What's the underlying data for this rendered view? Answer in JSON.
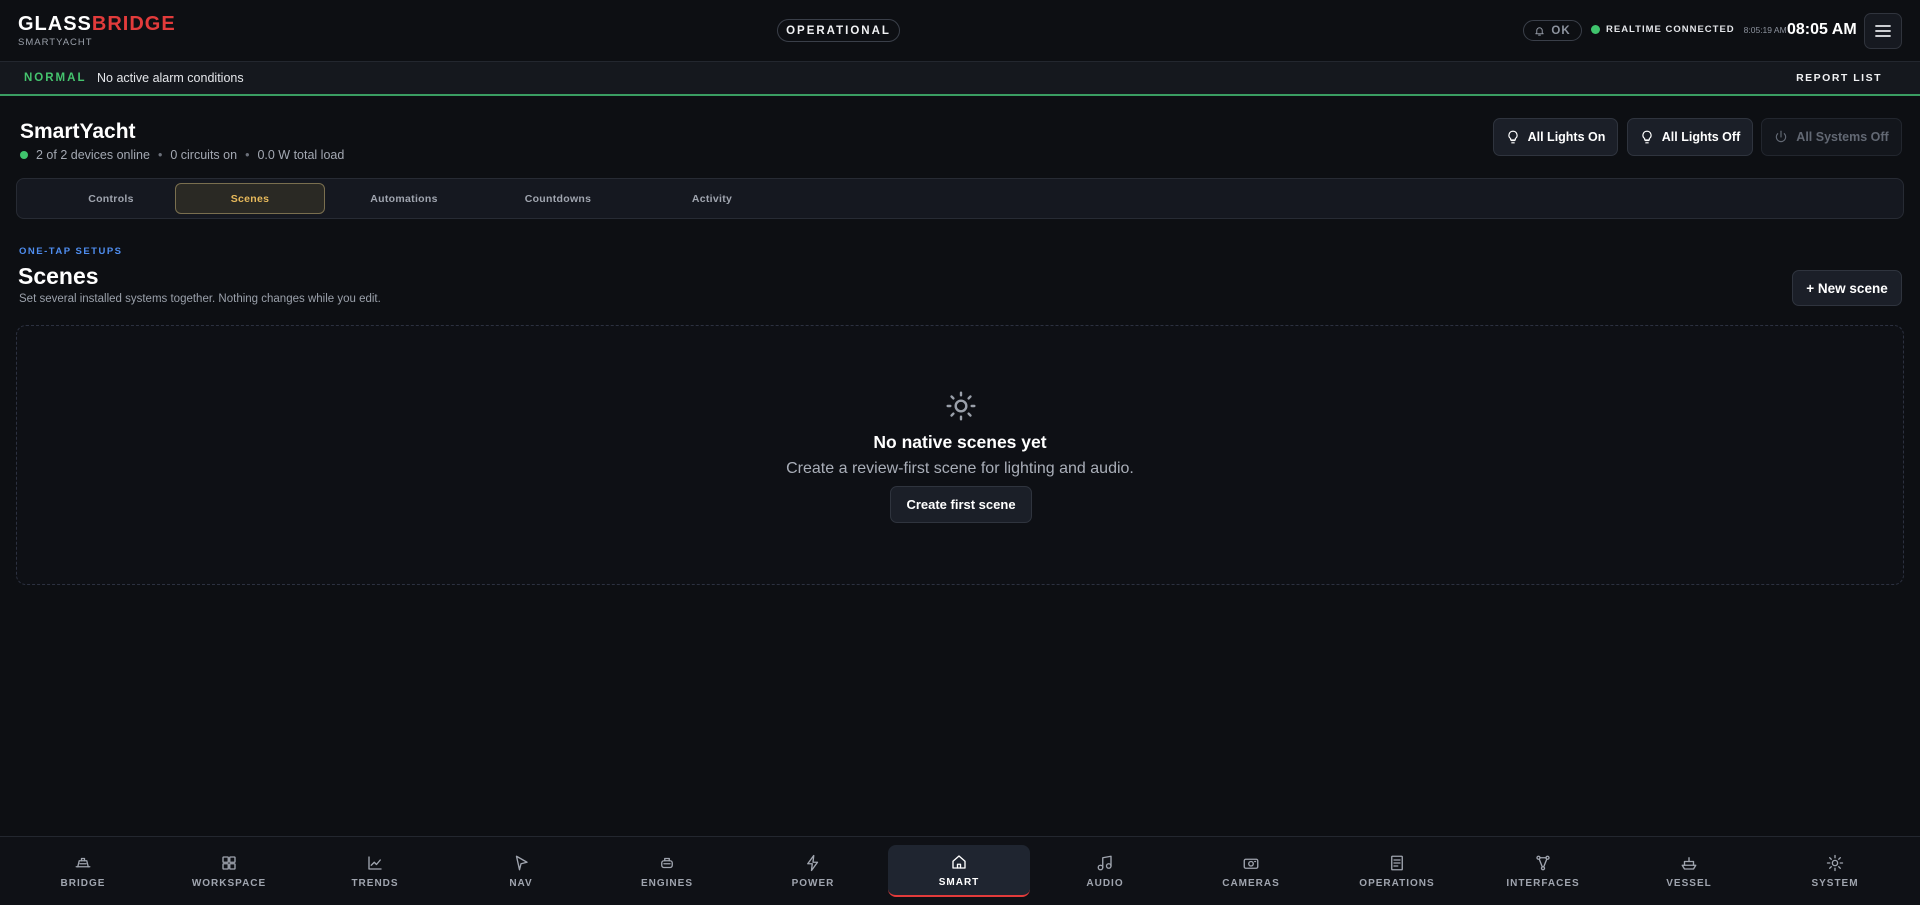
{
  "header": {
    "brand_part1": "GLASS",
    "brand_part2": "BRIDGE",
    "brand_sub": "SMARTYACHT",
    "status": "OPERATIONAL",
    "alerts_status": "OK",
    "connection_label": "REALTIME CONNECTED",
    "connection_time": "8:05:19 AM",
    "clock": "08:05 AM"
  },
  "alarm_bar": {
    "level": "NORMAL",
    "message": "No active alarm conditions",
    "report_link": "REPORT LIST"
  },
  "page": {
    "title": "SmartYacht",
    "devices_online": "2 of 2 devices online",
    "circuits_on": "0 circuits on",
    "total_load": "0.0 W total load"
  },
  "actions": {
    "all_lights_on": "All Lights On",
    "all_lights_off": "All Lights Off",
    "all_systems_off": "All Systems Off"
  },
  "tabs": [
    {
      "label": "Controls",
      "active": false
    },
    {
      "label": "Scenes",
      "active": true
    },
    {
      "label": "Automations",
      "active": false
    },
    {
      "label": "Countdowns",
      "active": false
    },
    {
      "label": "Activity",
      "active": false
    }
  ],
  "scenes": {
    "eyebrow": "ONE-TAP SETUPS",
    "title": "Scenes",
    "subtitle": "Set several installed systems together. Nothing changes while you edit.",
    "new_button": "+ New scene",
    "empty_title": "No native scenes yet",
    "empty_desc": "Create a review-first scene for lighting and audio.",
    "create_button": "Create first scene"
  },
  "bottom_nav": [
    {
      "label": "BRIDGE",
      "icon": "bridge-icon",
      "active": false
    },
    {
      "label": "WORKSPACE",
      "icon": "grid-icon",
      "active": false
    },
    {
      "label": "TRENDS",
      "icon": "chart-icon",
      "active": false
    },
    {
      "label": "NAV",
      "icon": "navigation-icon",
      "active": false
    },
    {
      "label": "ENGINES",
      "icon": "engine-icon",
      "active": false
    },
    {
      "label": "POWER",
      "icon": "bolt-icon",
      "active": false
    },
    {
      "label": "SMART",
      "icon": "home-icon",
      "active": true
    },
    {
      "label": "AUDIO",
      "icon": "music-icon",
      "active": false
    },
    {
      "label": "CAMERAS",
      "icon": "camera-icon",
      "active": false
    },
    {
      "label": "OPERATIONS",
      "icon": "document-icon",
      "active": false
    },
    {
      "label": "INTERFACES",
      "icon": "network-icon",
      "active": false
    },
    {
      "label": "VESSEL",
      "icon": "ship-icon",
      "active": false
    },
    {
      "label": "SYSTEM",
      "icon": "gear-icon",
      "active": false
    }
  ],
  "colors": {
    "brand_accent": "#e23b3b",
    "ok_green": "#3fc46d",
    "active_tab": "#e7b95b",
    "eyebrow_blue": "#4f8ef0"
  }
}
